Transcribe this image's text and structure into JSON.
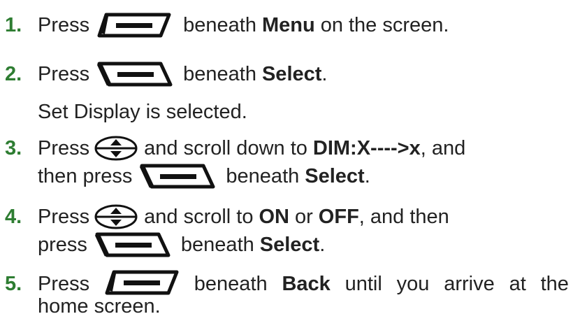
{
  "steps": [
    {
      "number": "1.",
      "lines": [
        {
          "press": "Press",
          "icon": "left-softkey-icon",
          "after": "beneath",
          "bold": "Menu",
          "tail": "on the screen."
        }
      ]
    },
    {
      "number": "2.",
      "lines": [
        {
          "press": "Press",
          "icon": "right-softkey-icon",
          "after": "beneath",
          "bold": "Select",
          "tail": "."
        }
      ],
      "note": "Set Display is selected."
    },
    {
      "number": "3.",
      "line1": {
        "press": "Press",
        "icon": "scroll-key-icon",
        "after": "and scroll down to",
        "bold": "DIM:X---->x",
        "tail": ", and"
      },
      "line2": {
        "press": "then press",
        "icon": "right-softkey-icon",
        "after": "beneath",
        "bold": "Select",
        "tail": "."
      }
    },
    {
      "number": "4.",
      "line1": {
        "press": "Press",
        "icon": "scroll-key-icon",
        "after": "and scroll to",
        "bold": "ON",
        "mid": "or",
        "bold2": "OFF",
        "tail": ", and then"
      },
      "line2": {
        "press": "press",
        "icon": "right-softkey-icon",
        "after": "beneath",
        "bold": "Select",
        "tail": "."
      }
    },
    {
      "number": "5.",
      "line1": {
        "press": "Press",
        "icon": "left-softkey-icon",
        "after": "beneath",
        "bold": "Back",
        "w1": "until",
        "w2": "you",
        "w3": "arrive",
        "w4": "at",
        "w5": "the"
      },
      "line2": {
        "text": "home screen."
      }
    }
  ],
  "colors": {
    "step_number": "#2e7d32",
    "text": "#222222",
    "icon_fill": "#111111"
  }
}
